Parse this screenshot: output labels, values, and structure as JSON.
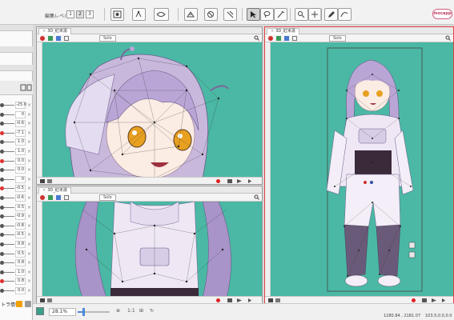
{
  "toolbar": {
    "edit_level_label": "編集レベル：",
    "levels": [
      "1",
      "2",
      "3"
    ],
    "logo_text": "mocapp"
  },
  "views": {
    "top_left": {
      "tab": "3D_紅米湯",
      "solo": "Solo"
    },
    "bottom_left": {
      "tab": "3D_紅米湯",
      "solo": "Solo"
    },
    "right": {
      "tab": "3D_紅米湯",
      "solo": "Solo"
    }
  },
  "parameters": [
    "-25.0",
    "0",
    "-0.6",
    "-7.1",
    "1.0",
    "1.0",
    "0.0",
    "0.0",
    "0",
    "-0.5",
    "-0.6",
    "0.5",
    "-0.9",
    "-0.8",
    "-0.5",
    "0.8",
    "0.5",
    "0.8",
    "1.0",
    "0.8",
    "0.0"
  ],
  "left_panel": {
    "bottom_label": "トラ情報"
  },
  "status": {
    "zoom": "28.1%",
    "zoom_fraction": 0.18,
    "ratio": "1:1",
    "coord_main": "1280.84 , 2181.07",
    "coord_small": "103.5,0.0,0.0"
  },
  "colors": {
    "canvas_bg": "#4ab8a4",
    "accent_red": "#e02020",
    "active_border": "#e04040"
  }
}
